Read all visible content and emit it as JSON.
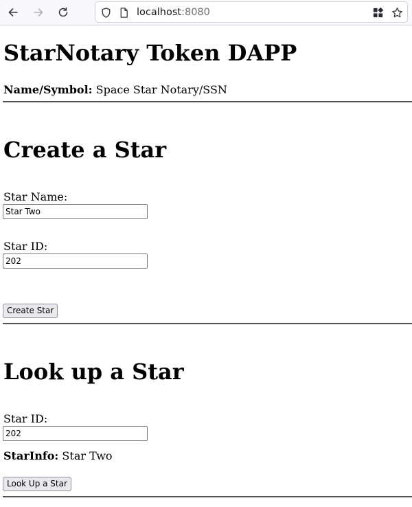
{
  "browser": {
    "url_host": "localhost",
    "url_port": ":8080",
    "back_icon": "arrow-left-icon",
    "forward_icon": "arrow-right-icon",
    "reload_icon": "reload-icon",
    "shield_icon": "shield-icon",
    "page_icon": "page-icon",
    "extensions_icon": "extensions-icon",
    "bookmark_icon": "star-outline-icon"
  },
  "page": {
    "title": "StarNotary Token DAPP",
    "name_symbol_label": "Name/Symbol:",
    "name_symbol_value": "Space Star Notary/SSN"
  },
  "create": {
    "heading": "Create a Star",
    "star_name_label": "Star Name:",
    "star_name_value": "Star Two",
    "star_id_label": "Star ID:",
    "star_id_value": "202",
    "button_label": "Create Star"
  },
  "lookup": {
    "heading": "Look up a Star",
    "star_id_label": "Star ID:",
    "star_id_value": "202",
    "star_info_label": "StarInfo:",
    "star_info_value": "Star Two",
    "button_label": "Look Up a Star"
  }
}
